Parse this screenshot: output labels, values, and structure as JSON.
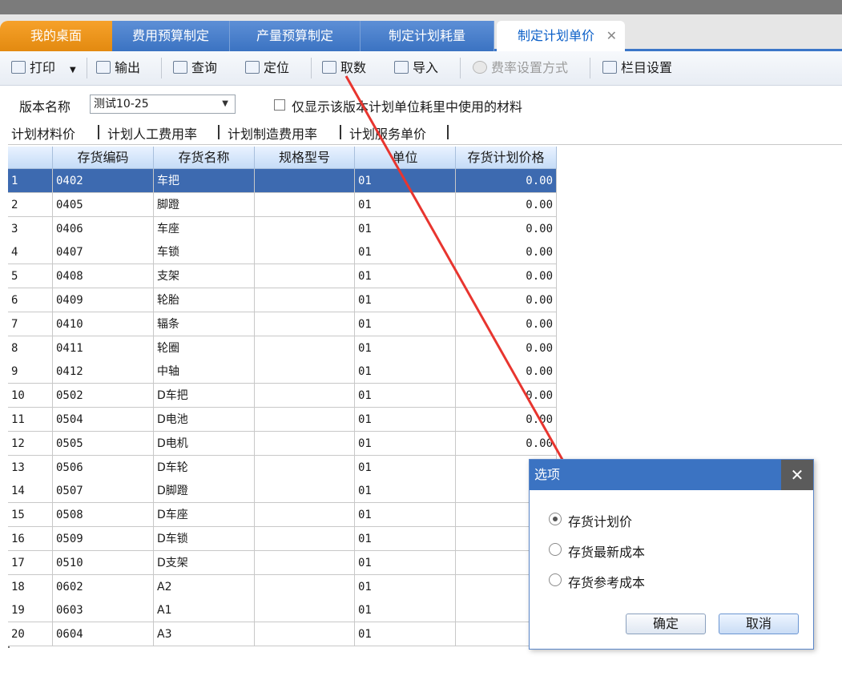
{
  "tabs": [
    {
      "label": "我的桌面"
    },
    {
      "label": "费用预算制定"
    },
    {
      "label": "产量预算制定"
    },
    {
      "label": "制定计划耗量"
    },
    {
      "label": "制定计划单价"
    }
  ],
  "toolbar": {
    "print": "打印",
    "export": "输出",
    "query": "查询",
    "locate": "定位",
    "fetch": "取数",
    "import": "导入",
    "rate_setting": "费率设置方式",
    "column_setting": "栏目设置"
  },
  "filters": {
    "version_label": "版本名称",
    "version_value": "测试10-25",
    "only_used_label": "仅显示该版本计划单位耗里中使用的材料"
  },
  "subtabs": [
    "计划材料价",
    "计划人工费用率",
    "计划制造费用率",
    "计划服务单价"
  ],
  "table": {
    "headers": [
      "存货编码",
      "存货名称",
      "规格型号",
      "单位",
      "存货计划价格"
    ],
    "rows": [
      {
        "n": "1",
        "code": "0402",
        "name": "车把",
        "spec": "",
        "unit": "01",
        "price": "0.00"
      },
      {
        "n": "2",
        "code": "0405",
        "name": "脚蹬",
        "spec": "",
        "unit": "01",
        "price": "0.00"
      },
      {
        "n": "3",
        "code": "0406",
        "name": "车座",
        "spec": "",
        "unit": "01",
        "price": "0.00"
      },
      {
        "n": "4",
        "code": "0407",
        "name": "车锁",
        "spec": "",
        "unit": "01",
        "price": "0.00"
      },
      {
        "n": "5",
        "code": "0408",
        "name": "支架",
        "spec": "",
        "unit": "01",
        "price": "0.00"
      },
      {
        "n": "6",
        "code": "0409",
        "name": "轮胎",
        "spec": "",
        "unit": "01",
        "price": "0.00"
      },
      {
        "n": "7",
        "code": "0410",
        "name": "辐条",
        "spec": "",
        "unit": "01",
        "price": "0.00"
      },
      {
        "n": "8",
        "code": "0411",
        "name": "轮圈",
        "spec": "",
        "unit": "01",
        "price": "0.00"
      },
      {
        "n": "9",
        "code": "0412",
        "name": "中轴",
        "spec": "",
        "unit": "01",
        "price": "0.00"
      },
      {
        "n": "10",
        "code": "0502",
        "name": "D车把",
        "spec": "",
        "unit": "01",
        "price": "0.00"
      },
      {
        "n": "11",
        "code": "0504",
        "name": "D电池",
        "spec": "",
        "unit": "01",
        "price": "0.00"
      },
      {
        "n": "12",
        "code": "0505",
        "name": "D电机",
        "spec": "",
        "unit": "01",
        "price": "0.00"
      },
      {
        "n": "13",
        "code": "0506",
        "name": "D车轮",
        "spec": "",
        "unit": "01",
        "price": ""
      },
      {
        "n": "14",
        "code": "0507",
        "name": "D脚蹬",
        "spec": "",
        "unit": "01",
        "price": ""
      },
      {
        "n": "15",
        "code": "0508",
        "name": "D车座",
        "spec": "",
        "unit": "01",
        "price": ""
      },
      {
        "n": "16",
        "code": "0509",
        "name": "D车锁",
        "spec": "",
        "unit": "01",
        "price": ""
      },
      {
        "n": "17",
        "code": "0510",
        "name": "D支架",
        "spec": "",
        "unit": "01",
        "price": ""
      },
      {
        "n": "18",
        "code": "0602",
        "name": "A2",
        "spec": "",
        "unit": "01",
        "price": ""
      },
      {
        "n": "19",
        "code": "0603",
        "name": "A1",
        "spec": "",
        "unit": "01",
        "price": ""
      },
      {
        "n": "20",
        "code": "0604",
        "name": "A3",
        "spec": "",
        "unit": "01",
        "price": ""
      }
    ]
  },
  "dialog": {
    "title": "选项",
    "options": [
      "存货计划价",
      "存货最新成本",
      "存货参考成本"
    ],
    "selected": "存货计划价",
    "ok": "确定",
    "cancel": "取消"
  },
  "colors": {
    "accent": "#3b73c2",
    "active_tab": "#f39c1f",
    "selected_row": "#3d6ab0",
    "annotation_arrow": "#e8352f"
  }
}
